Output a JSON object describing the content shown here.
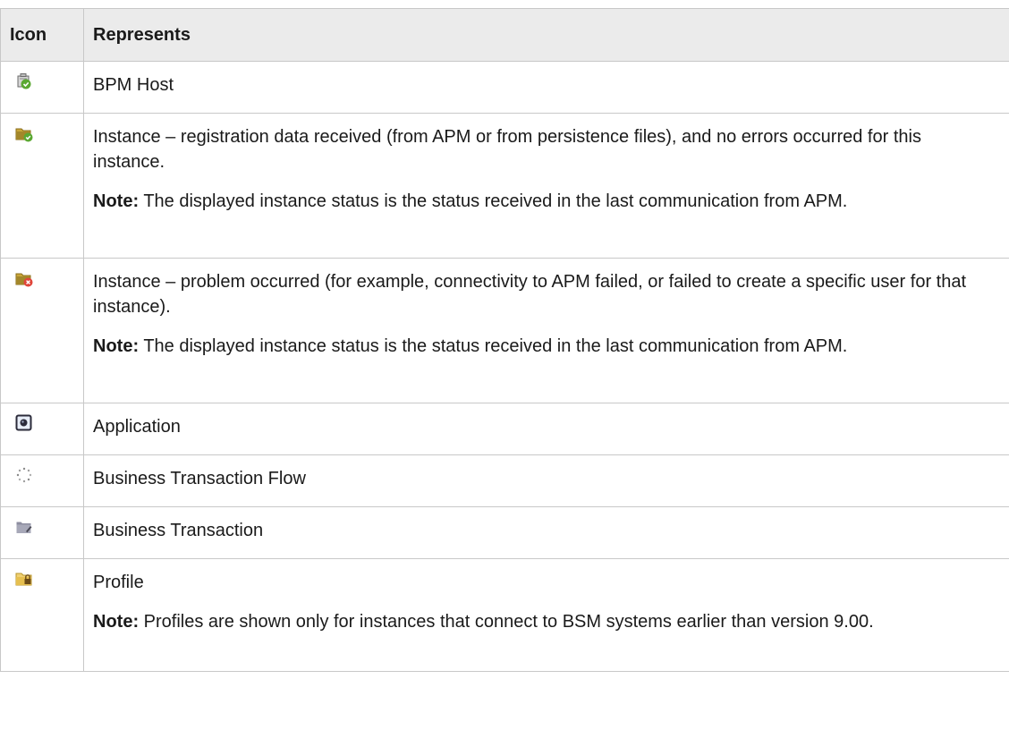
{
  "table": {
    "headers": {
      "icon": "Icon",
      "represents": "Represents"
    },
    "rows": [
      {
        "icon": "bpm-host-icon",
        "text": "BPM Host"
      },
      {
        "icon": "instance-ok-icon",
        "text": "Instance – registration data received (from APM or from persistence files), and no errors occurred for this instance.",
        "note_label": "Note:",
        "note_text": "The displayed instance status is the status received in the last communication from APM."
      },
      {
        "icon": "instance-error-icon",
        "text": "Instance – problem occurred (for example, connectivity to APM failed, or failed to create a specific user for that instance).",
        "note_label": "Note:",
        "note_text": "The displayed instance status is the status received in the last communication from APM."
      },
      {
        "icon": "application-icon",
        "text": "Application"
      },
      {
        "icon": "business-transaction-flow-icon",
        "text": "Business Transaction Flow"
      },
      {
        "icon": "business-transaction-icon",
        "text": "Business Transaction"
      },
      {
        "icon": "profile-icon",
        "text": "Profile",
        "note_label": "Note:",
        "note_text": "Profiles are shown only for instances that connect to BSM systems earlier than version 9.00."
      }
    ]
  },
  "colors": {
    "header_bg": "#ebebeb",
    "border": "#c8c8c8",
    "ok_green": "#5aa832",
    "error_red": "#e0453a",
    "folder_gold": "#b8962e"
  }
}
